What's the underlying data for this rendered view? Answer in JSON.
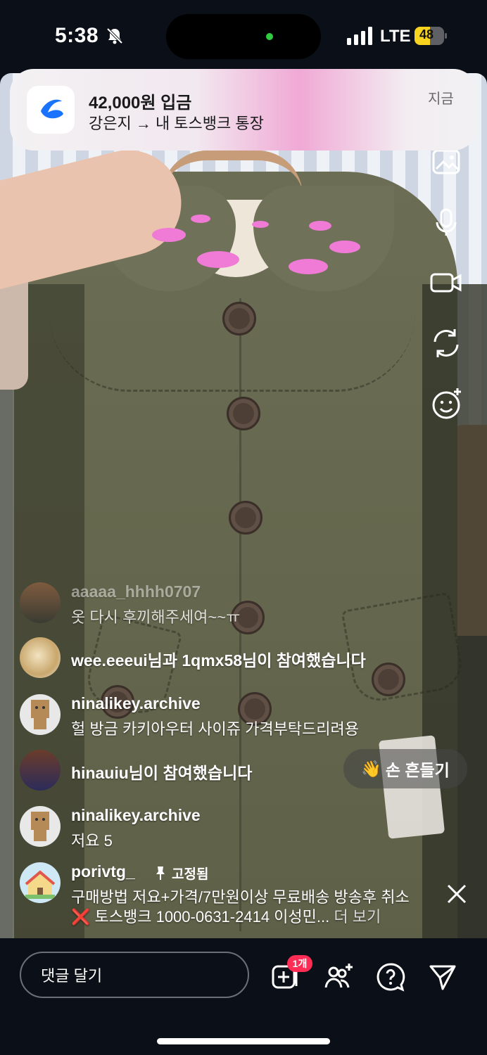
{
  "status_bar": {
    "time": "5:38",
    "network": "LTE",
    "battery": "48"
  },
  "notification": {
    "title": "42,000원 입금",
    "body": "강은지 → 내 토스뱅크 통장",
    "time": "지금",
    "app_icon": "toss-icon"
  },
  "side_toolbar": [
    "gallery-icon",
    "mic-icon",
    "video-camera-icon",
    "switch-camera-icon",
    "add-emoji-icon"
  ],
  "comments": [
    {
      "type": "message",
      "user": "aaaaa_hhhh0707",
      "text": "옷 다시 후끼해주세여~~ㅠ",
      "faded": true
    },
    {
      "type": "join",
      "text": "wee.eeeui님과 1qmx58님이 참여했습니다"
    },
    {
      "type": "message",
      "user": "ninalikey.archive",
      "text": "헐 방금 카키아우터 사이쥬 가격부탁드리려용"
    },
    {
      "type": "join",
      "text": "hinauiu님이 참여했습니다"
    },
    {
      "type": "message",
      "user": "ninalikey.archive",
      "text": "저요 5"
    }
  ],
  "wave_button": {
    "emoji": "👋",
    "label": "손 흔들기"
  },
  "pinned": {
    "user": "porivtg_",
    "pin_label": "고정됨",
    "line1": "구매방법 저요+가격/7만원이상 무료배송 방송후 취소",
    "line2": "❌ 토스뱅크 1000-0631-2414 이성민...",
    "more": "더 보기"
  },
  "bottom_bar": {
    "comment_placeholder": "댓글 달기",
    "badge": "1개",
    "icons": [
      "add-product-icon",
      "add-guest-icon",
      "question-icon",
      "send-icon"
    ]
  },
  "colors": {
    "background": "#0b0f17",
    "badge": "#ff2d55",
    "toss_blue": "#1a73ff"
  }
}
